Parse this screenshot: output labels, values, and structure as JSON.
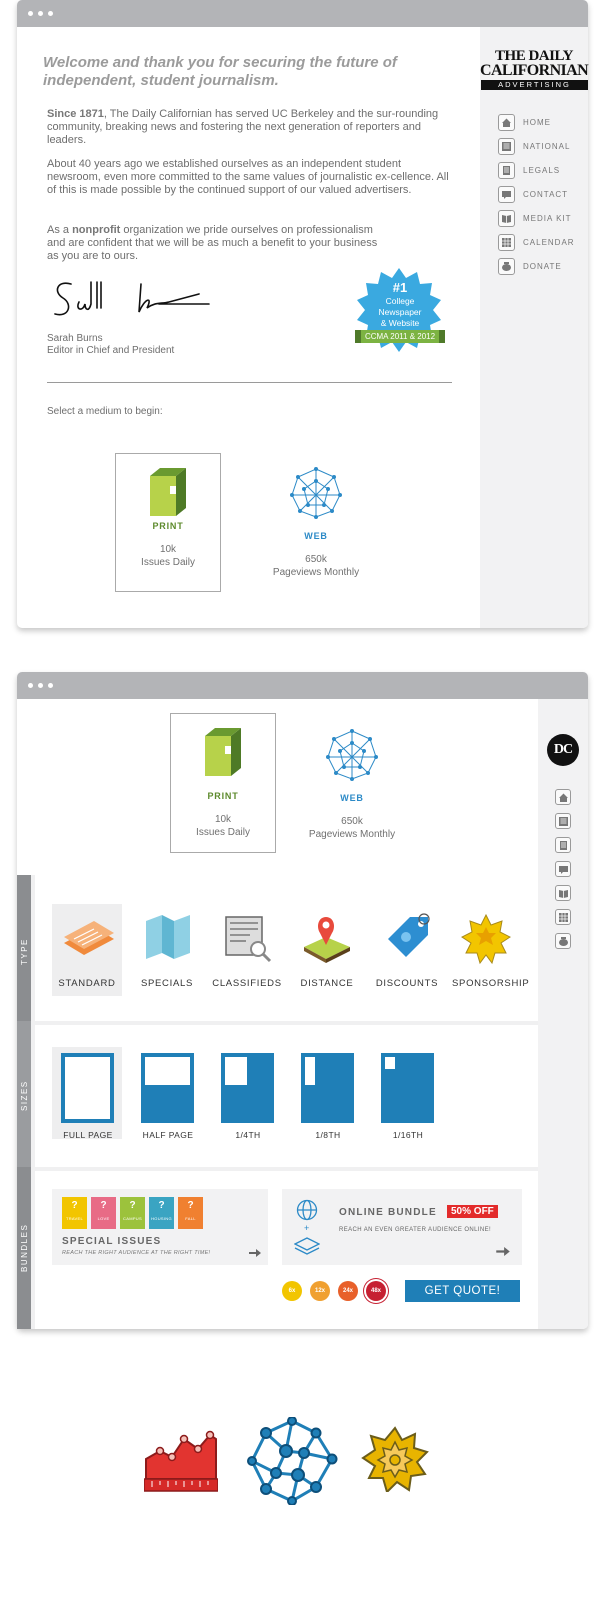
{
  "colors": {
    "accent_blue": "#1f7fb7",
    "green": "#5d8a2c",
    "gray_bar": "#b3b4b7",
    "badge_blue": "#3aa9e0"
  },
  "window1": {
    "heading": "Welcome and thank you for securing the future of independent, student journalism.",
    "para1_bold": "Since 1871",
    "para1": ", The Daily Californian has served UC Berkeley and the sur-rounding community, breaking news and fostering the next generation of reporters and leaders.",
    "para2": "About 40 years ago we established ourselves as an independent student newsroom, even more committed to the same values of journalistic ex-cellence. All of this is made possible by the continued support of our valued advertisers.",
    "para3_pre": "As a ",
    "para3_bold": "nonprofit",
    "para3_post": " organization we pride ourselves on professionalism and are confident that we will be as much a benefit to your business as you are to ours.",
    "signature_name": "Sarah Burns",
    "signature_title": "Editor in Chief and President",
    "badge": {
      "rank": "#1",
      "line1": "College",
      "line2": "Newspaper",
      "line3": "& Website",
      "ribbon": "CCMA 2011 & 2012"
    },
    "select_prompt": "Select a medium to begin:",
    "logo_line1": "THE DAILY",
    "logo_line2": "CALIFORNIAN",
    "logo_sub": "ADVERTISING",
    "nav": [
      {
        "label": "HOME",
        "icon": "home-icon"
      },
      {
        "label": "NATIONAL",
        "icon": "newspaper-icon"
      },
      {
        "label": "LEGALS",
        "icon": "document-icon"
      },
      {
        "label": "CONTACT",
        "icon": "chat-icon"
      },
      {
        "label": "MEDIA KIT",
        "icon": "book-icon"
      },
      {
        "label": "CALENDAR",
        "icon": "calendar-icon"
      },
      {
        "label": "DONATE",
        "icon": "piggy-bank-icon"
      }
    ],
    "print": {
      "label": "PRINT",
      "count": "10k",
      "desc": "Issues Daily"
    },
    "web": {
      "label": "WEB",
      "count": "650k",
      "desc": "Pageviews Monthly"
    }
  },
  "window2": {
    "logo": "DC",
    "print": {
      "label": "PRINT",
      "count": "10k",
      "desc": "Issues Daily"
    },
    "web": {
      "label": "WEB",
      "count": "650k",
      "desc": "Pageviews Monthly"
    },
    "section_type": "TYPE",
    "section_sizes": "SIZES",
    "section_bundles": "BUNDLES",
    "types": [
      "STANDARD",
      "SPECIALS",
      "CLASSIFIEDS",
      "DISTANCE",
      "DISCOUNTS",
      "SPONSORSHIP"
    ],
    "sizes": [
      "FULL PAGE",
      "HALF PAGE",
      "1/4TH",
      "1/8TH",
      "1/16TH"
    ],
    "special_issues": {
      "title": "SPECIAL ISSUES",
      "subtitle": "REACH THE RIGHT AUDIENCE AT THE RIGHT TIME!",
      "tiles": [
        {
          "label": "TRAVEL",
          "color": "#f2c500"
        },
        {
          "label": "LOVE",
          "color": "#e86b86"
        },
        {
          "label": "CAMPUS",
          "color": "#9cc23c"
        },
        {
          "label": "HOUSING",
          "color": "#3aa4c2"
        },
        {
          "label": "FALL",
          "color": "#f08030"
        }
      ],
      "question": "?"
    },
    "online_bundle": {
      "title": "ONLINE BUNDLE",
      "discount": "50% OFF",
      "subtitle": "REACH AN EVEN GREATER AUDIENCE ONLINE!",
      "plus": "+"
    },
    "frequencies": [
      {
        "label": "6x",
        "color": "#f2c500"
      },
      {
        "label": "12x",
        "color": "#f0a030"
      },
      {
        "label": "24x",
        "color": "#e8602a"
      },
      {
        "label": "48x",
        "color": "#c62032"
      }
    ],
    "cta": "GET QUOTE!"
  }
}
